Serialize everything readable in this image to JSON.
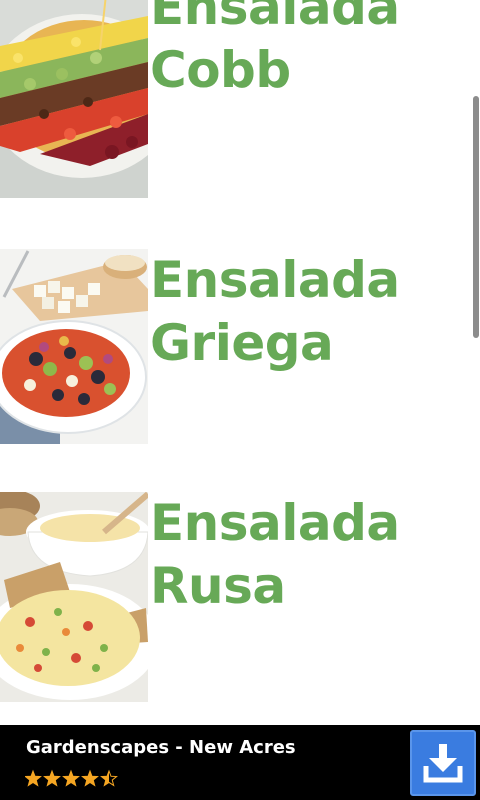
{
  "recipes": [
    {
      "title": "Ensalada Cobb",
      "image": "cobb-salad-photo"
    },
    {
      "title": "Ensalada Griega",
      "image": "greek-salad-photo"
    },
    {
      "title": "Ensalada Rusa",
      "image": "russian-salad-photo"
    }
  ],
  "ad": {
    "title": "Gardenscapes - New Acres",
    "rating": 4.5,
    "rating_max": 5,
    "download_icon": "download-icon"
  },
  "colors": {
    "title_green": "#67a957",
    "ad_background": "#000000",
    "download_button": "#3a7ce0",
    "star": "#f5a623"
  }
}
